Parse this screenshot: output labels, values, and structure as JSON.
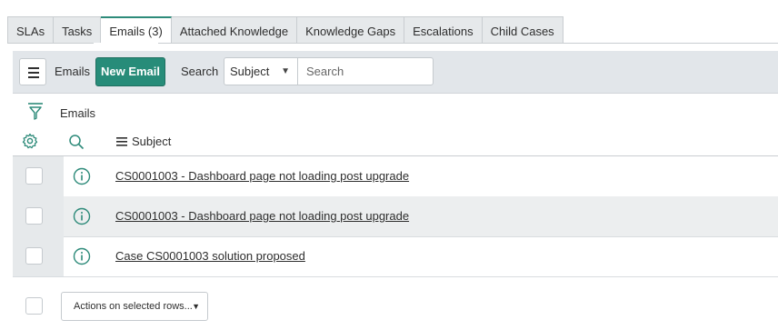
{
  "tabs": [
    "SLAs",
    "Tasks",
    "Emails (3)",
    "Attached Knowledge",
    "Knowledge Gaps",
    "Escalations",
    "Child Cases"
  ],
  "active_tab": "Emails (3)",
  "toolbar": {
    "list_label": "Emails",
    "new_button": "New Email",
    "search_label": "Search",
    "search_field": "Subject",
    "search_placeholder": "Search"
  },
  "list": {
    "title": "Emails",
    "column": "Subject",
    "rows": [
      "CS0001003 - Dashboard page not loading post upgrade",
      "CS0001003 - Dashboard page not loading post upgrade",
      "Case CS0001003 solution proposed"
    ]
  },
  "footer": {
    "actions_label": "Actions on selected rows..."
  },
  "colors": {
    "accent": "#278c79",
    "toolbar_bg": "#e2e6ea",
    "icon": "#2e8b7a"
  },
  "icons": [
    "menu-icon",
    "filter-icon",
    "gear-icon",
    "search-icon",
    "list-icon",
    "info-icon",
    "chevron-down-icon"
  ]
}
